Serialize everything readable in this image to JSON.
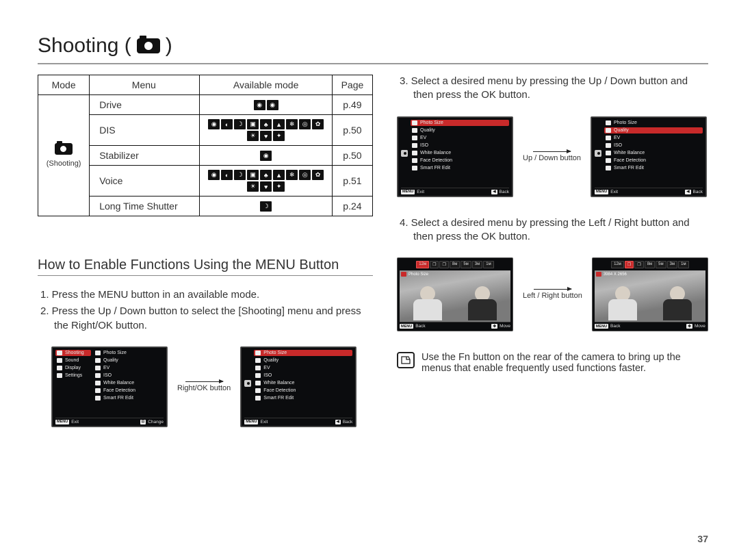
{
  "title": "Shooting (",
  "title_suffix": " )",
  "page_number": "37",
  "table": {
    "headers": {
      "mode": "Mode",
      "menu": "Menu",
      "avail": "Available mode",
      "page": "Page"
    },
    "mode_label": "(Shooting)",
    "rows": [
      {
        "menu": "Drive",
        "page": "p.49",
        "icons": 2
      },
      {
        "menu": "DIS",
        "page": "p.50",
        "icons": 12
      },
      {
        "menu": "Stabilizer",
        "page": "p.50",
        "icons": 1
      },
      {
        "menu": "Voice",
        "page": "p.51",
        "icons": 12
      },
      {
        "menu": "Long Time Shutter",
        "page": "p.24",
        "icons": 1
      }
    ]
  },
  "subtitle": "How to Enable Functions Using the MENU Button",
  "steps_left": [
    "1. Press the MENU button in an available mode.",
    "2. Press the Up / Down button to select the [Shooting] menu and press the Right/OK button."
  ],
  "label_rightok": "Right/OK button",
  "steps_right": [
    "3. Select a desired menu by pressing the Up / Down button and then press the OK button.",
    "4. Select a desired menu by pressing the Left / Right button and then press the OK button."
  ],
  "label_updown": "Up / Down button",
  "label_leftright": "Left / Right button",
  "note": "Use the Fn button on the rear of the camera to bring up the menus that enable frequently used functions faster.",
  "lcd_left_menu": [
    "Shooting",
    "Sound",
    "Display",
    "Settings"
  ],
  "lcd_right_menu": [
    "Photo Size",
    "Quality",
    "EV",
    "ISO",
    "White Balance",
    "Face Detection",
    "Smart FR Edit"
  ],
  "footer": {
    "exit": "Exit",
    "change": "Change",
    "back": "Back",
    "move": "Move",
    "menu": "MENU"
  },
  "sizes": [
    "12м",
    "❐",
    "❐",
    "8м",
    "5м",
    "3м",
    "1м"
  ],
  "photo_label1": "Photo Size",
  "photo_label2": "3984 X 2656"
}
